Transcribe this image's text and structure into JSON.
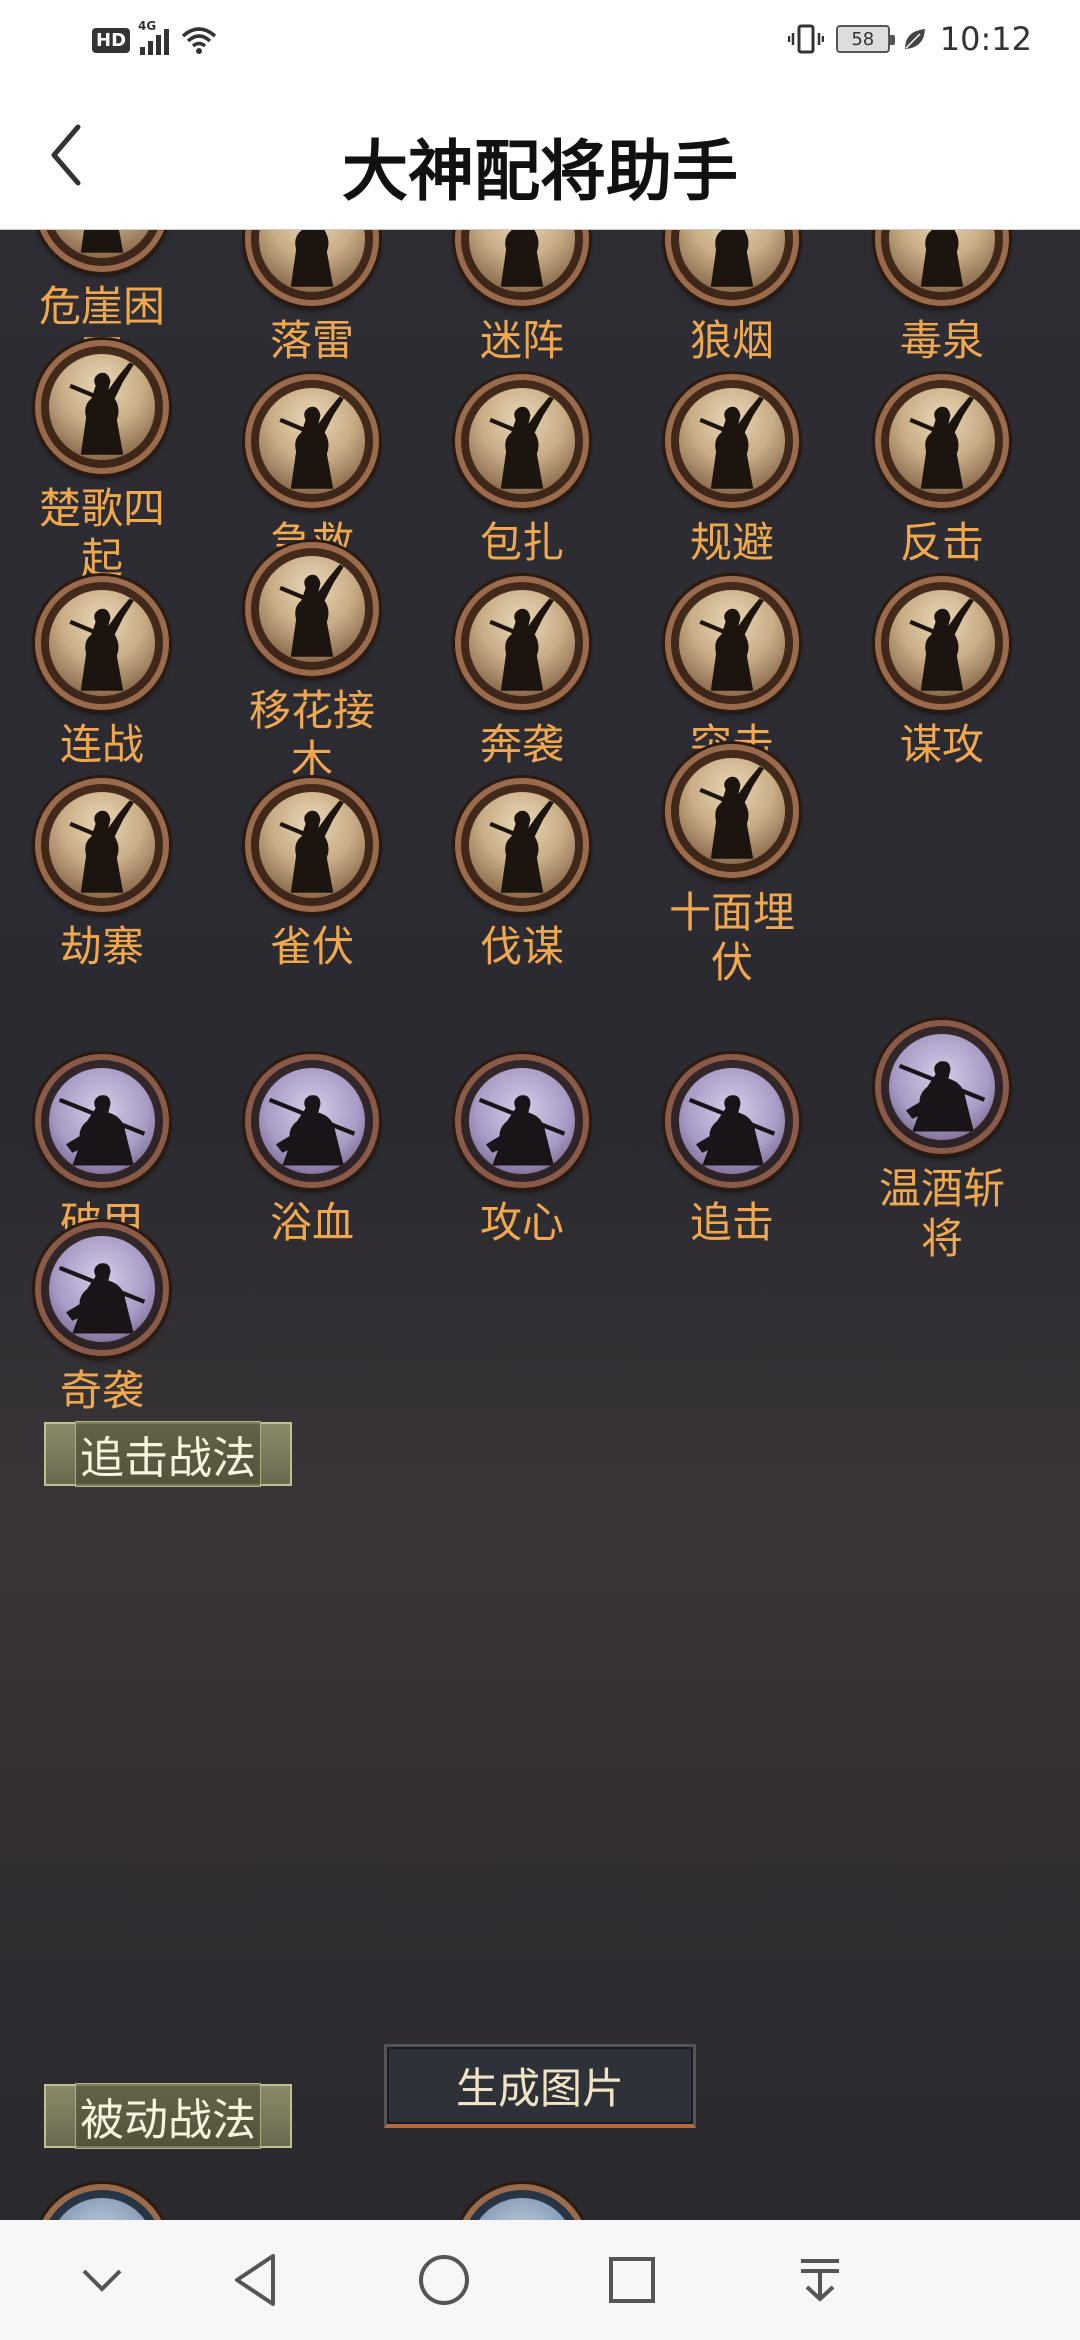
{
  "status_bar": {
    "hd_label": "HD",
    "signal_label": "4G",
    "battery_level": "58",
    "time": "10:12"
  },
  "header": {
    "title": "大神配将助手"
  },
  "grid_top": {
    "rows": [
      [
        "危崖困军",
        "落雷",
        "迷阵",
        "狼烟",
        "毒泉"
      ],
      [
        "楚歌四起",
        "急救",
        "包扎",
        "规避",
        "反击"
      ],
      [
        "连战",
        "移花接木",
        "奔袭",
        "突击",
        "谋攻"
      ],
      [
        "劫寨",
        "雀伏",
        "伐谋",
        "十面埋伏"
      ]
    ]
  },
  "sections": {
    "pursuit": "追击战法",
    "passive": "被动战法"
  },
  "grid_pursuit": {
    "rows": [
      [
        "破甲",
        "浴血",
        "攻心",
        "追击",
        "温酒斩将"
      ],
      [
        "奇袭"
      ]
    ]
  },
  "generate_button": "生成图片",
  "colors": {
    "label": "#f0a850",
    "background": "#2b2b31"
  }
}
